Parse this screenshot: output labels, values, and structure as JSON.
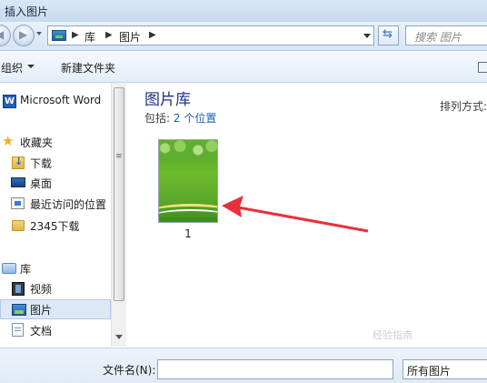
{
  "window": {
    "title": "插入图片"
  },
  "address": {
    "segments": [
      "库",
      "图片"
    ],
    "search_placeholder": "搜索 图片"
  },
  "toolbar": {
    "organize_label": "组织",
    "new_folder_label": "新建文件夹"
  },
  "nav": {
    "items": [
      {
        "label": "Microsoft Word",
        "icon": "word-icon"
      },
      {
        "label": "收藏夹",
        "icon": "star-icon"
      },
      {
        "label": "下载",
        "icon": "download-folder-icon"
      },
      {
        "label": "桌面",
        "icon": "desktop-icon"
      },
      {
        "label": "最近访问的位置",
        "icon": "recent-places-icon"
      },
      {
        "label": "2345下载",
        "icon": "folder-icon"
      },
      {
        "label": "库",
        "icon": "library-icon"
      },
      {
        "label": "视频",
        "icon": "video-icon"
      },
      {
        "label": "图片",
        "icon": "pictures-icon",
        "selected": true
      },
      {
        "label": "文档",
        "icon": "documents-icon"
      }
    ]
  },
  "content": {
    "library_title": "图片库",
    "includes_prefix": "包括:",
    "includes_link": "2 个位置",
    "arrange_label": "排列方式:",
    "files": [
      {
        "name": "1"
      }
    ]
  },
  "bottom": {
    "filename_label": "文件名(N):",
    "filename_value": "",
    "filetype_value": "所有图片"
  },
  "watermark": "经验指南",
  "colors": {
    "title_blue": "#1e3287",
    "link_blue": "#1a5fb4",
    "selection": "#dce8f6",
    "arrow_red": "#e8303a"
  }
}
